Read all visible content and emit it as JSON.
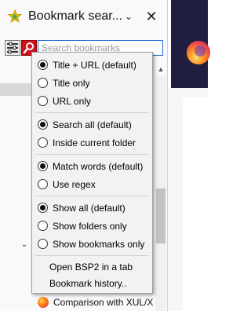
{
  "sidebar": {
    "title": "Bookmark sear...",
    "search_placeholder": "Search bookmarks",
    "bg_item_label": "Comparison with XUL/X"
  },
  "menu": {
    "groups": [
      [
        "Title + URL (default)",
        "Title only",
        "URL only"
      ],
      [
        "Search all (default)",
        "Inside current folder"
      ],
      [
        "Match words (default)",
        "Use regex"
      ],
      [
        "Show all (default)",
        "Show folders only",
        "Show bookmarks only"
      ]
    ],
    "title_url_default": "Title + URL (default)",
    "title_only": "Title only",
    "url_only": "URL only",
    "search_all_default": "Search all (default)",
    "inside_current_folder": "Inside current folder",
    "match_words_default": "Match words (default)",
    "use_regex": "Use regex",
    "show_all_default": "Show all (default)",
    "show_folders_only": "Show folders only",
    "show_bookmarks_only": "Show bookmarks only",
    "open_in_tab": "Open BSP2 in a tab",
    "bookmark_history": "Bookmark history.."
  },
  "colors": {
    "menu_bg": "#f2f2f2",
    "search_border": "#1f6fd1",
    "filter_button_active": "#d1101a",
    "star": "#f5c400"
  },
  "icons": {
    "header": "star-icon",
    "dropdown": "chevron-down-icon",
    "close": "close-icon",
    "filter_settings": "filter-settings-icon",
    "search_button": "magnifier-icon",
    "browser_logo": "firefox-logo-icon"
  }
}
